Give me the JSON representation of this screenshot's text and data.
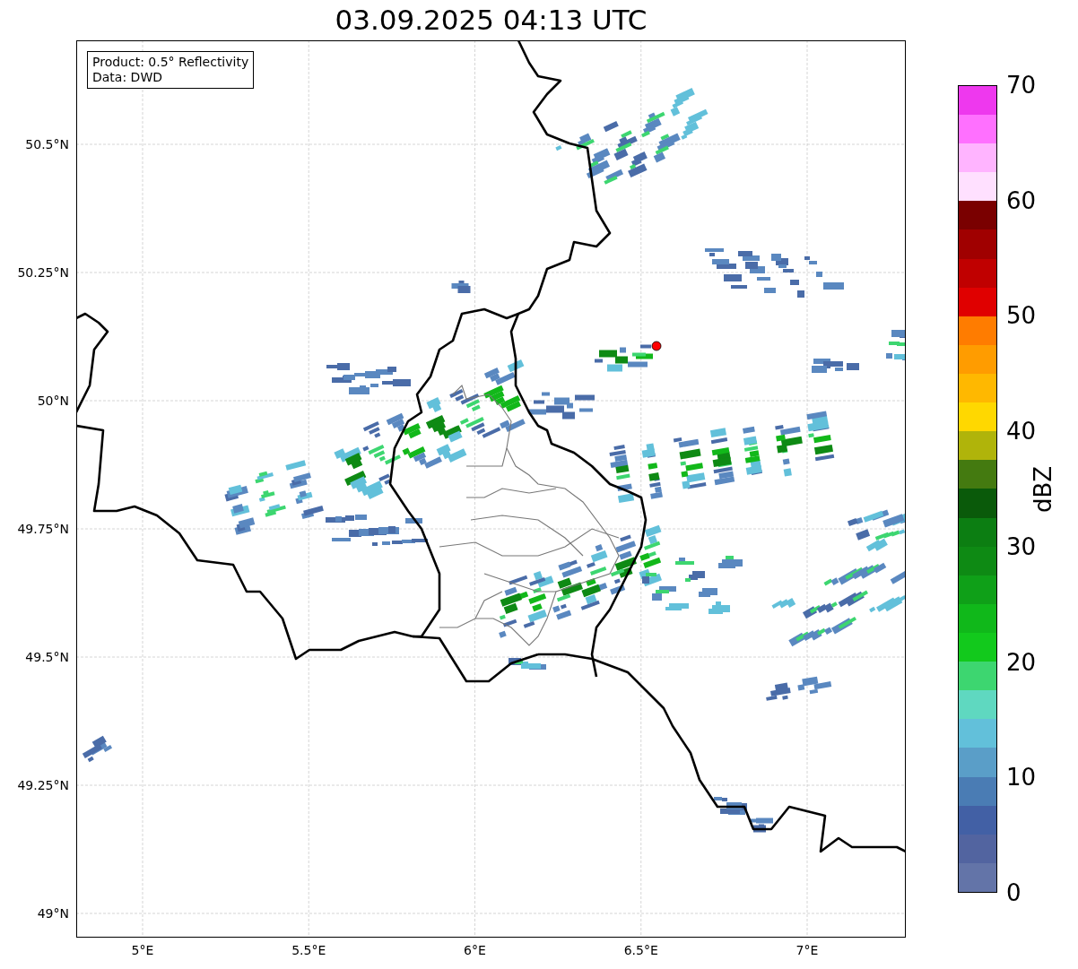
{
  "title": "03.09.2025 04:13 UTC",
  "legend": [
    "Product: 0.5° Reflectivity",
    "Data: DWD"
  ],
  "y_ticks": [
    "50.5°N",
    "50.25°N",
    "50°N",
    "49.75°N",
    "49.5°N",
    "49.25°N",
    "49°N"
  ],
  "x_ticks": [
    "5°E",
    "5.5°E",
    "6°E",
    "6.5°E",
    "7°E"
  ],
  "colorbar": {
    "label": "dBZ",
    "ticks": [
      "70",
      "60",
      "50",
      "40",
      "30",
      "20",
      "10",
      "0"
    ],
    "segments": [
      {
        "color": "#6374a8"
      },
      {
        "color": "#5264a0"
      },
      {
        "color": "#4260a5"
      },
      {
        "color": "#4a7cb4"
      },
      {
        "color": "#5a9ec8"
      },
      {
        "color": "#62c0da"
      },
      {
        "color": "#5fd8c0"
      },
      {
        "color": "#3dd670"
      },
      {
        "color": "#12c91c"
      },
      {
        "color": "#10b81a"
      },
      {
        "color": "#0fa018"
      },
      {
        "color": "#0e8a14"
      },
      {
        "color": "#0c7e12"
      },
      {
        "color": "#0a5a0a"
      },
      {
        "color": "#447a10"
      },
      {
        "color": "#b0b40a"
      },
      {
        "color": "#ffd800"
      },
      {
        "color": "#ffb800"
      },
      {
        "color": "#ff9c00"
      },
      {
        "color": "#ff7c00"
      },
      {
        "color": "#e00000"
      },
      {
        "color": "#c00000"
      },
      {
        "color": "#a00000"
      },
      {
        "color": "#7a0000"
      },
      {
        "color": "#ffe0ff"
      },
      {
        "color": "#ffb4ff"
      },
      {
        "color": "#ff70ff"
      },
      {
        "color": "#ee38ee"
      }
    ]
  }
}
